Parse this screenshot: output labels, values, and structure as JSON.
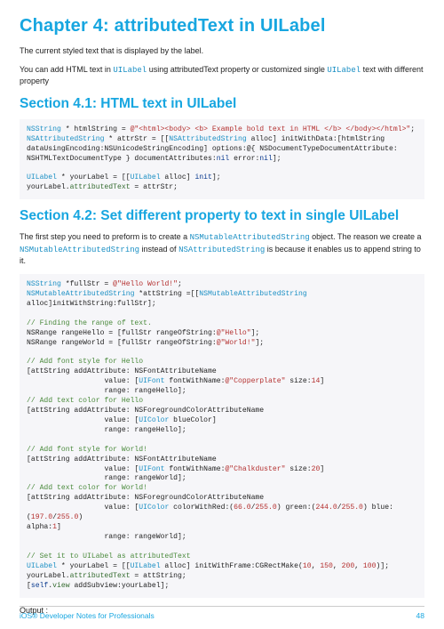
{
  "chapter_title": "Chapter 4: attributedText in UILabel",
  "intro_line": "The current styled text that is displayed by the label.",
  "intro_para_pre": "You can add HTML text in ",
  "intro_para_code": "UILabel",
  "intro_para_mid": " using attributedText property or customized single ",
  "intro_para_code2": "UILabel",
  "intro_para_post": " text with different property",
  "section41_title": "Section 4.1: HTML text in UILabel",
  "section42_title": "Section 4.2: Set different property to text in single UILabel",
  "section42_para_pre": "The first step you need to preform is to create a ",
  "section42_para_code1": "NSMutableAttributedString",
  "section42_para_mid": " object. The reason we create a ",
  "section42_para_code2": "NSMutableAttributedString",
  "section42_para_mid2": " instead of ",
  "section42_para_code3": "NSAttributedString",
  "section42_para_post": " is because it enables us to append string to it.",
  "output_label": "Output :",
  "footer_left": "iOS® Developer Notes for Professionals",
  "footer_right": "48",
  "code41": {
    "l1a": "NSString",
    "l1b": " * htmlString = ",
    "l1c": "@\"<html><body> <b> Example bold text in HTML </b> </body></html>\"",
    "l1d": ";",
    "l2a": "NSAttributedString",
    "l2b": " * attrStr = [[",
    "l2c": "NSAttributedString",
    "l2d": " alloc] initWithData:[htmlString",
    "l3": "dataUsingEncoding:NSUnicodeStringEncoding] options:@{ NSDocumentTypeDocumentAttribute:",
    "l4a": "NSHTMLTextDocumentType } documentAttributes:",
    "l4b": "nil",
    "l4c": " error:",
    "l4d": "nil",
    "l4e": "];",
    "l5a": "UILabel",
    "l5b": " * yourLabel = [[",
    "l5c": "UILabel",
    "l5d": " alloc] ",
    "l5e": "init",
    "l5f": "];",
    "l6a": "yourLabel.",
    "l6b": "attributedText",
    "l6c": " = attrStr;"
  },
  "code42": {
    "l1a": "NSString",
    "l1b": " *fullStr = ",
    "l1c": "@\"Hello World!\"",
    "l1d": ";",
    "l2a": "NSMutableAttributedString",
    "l2b": " *attString =[[",
    "l2c": "NSMutableAttributedString",
    "l2d": " alloc]initWithString:fullStr];",
    "c1": "// Finding the range of text.",
    "l3a": "NSRange rangeHello = [fullStr rangeOfString:",
    "l3b": "@\"Hello\"",
    "l3c": "];",
    "l4a": "NSRange rangeWorld = [fullStr rangeOfString:",
    "l4b": "@\"World!\"",
    "l4c": "];",
    "c2": "// Add font style for Hello",
    "l5": "[attString addAttribute: NSFontAttributeName",
    "l6a": "                  value: [",
    "l6b": "UIFont",
    "l6c": " fontWithName:",
    "l6d": "@\"Copperplate\"",
    "l6e": " size:",
    "l6f": "14",
    "l6g": "]",
    "l7": "                  range: rangeHello];",
    "c3": "// Add text color for Hello",
    "l8": "[attString addAttribute: NSForegroundColorAttributeName",
    "l9a": "                  value: [",
    "l9b": "UIColor",
    "l9c": " blueColor]",
    "l10": "                  range: rangeHello];",
    "c4": "// Add font style for World!",
    "l11": "[attString addAttribute: NSFontAttributeName",
    "l12a": "                  value: [",
    "l12b": "UIFont",
    "l12c": " fontWithName:",
    "l12d": "@\"Chalkduster\"",
    "l12e": " size:",
    "l12f": "20",
    "l12g": "]",
    "l13": "                  range: rangeWorld];",
    "c5": "// Add text color for World!",
    "l14": "[attString addAttribute: NSForegroundColorAttributeName",
    "l15a": "                  value: [",
    "l15b": "UIColor",
    "l15c": " colorWithRed:(",
    "l15d": "66.0",
    "l15e": "/",
    "l15f": "255.0",
    "l15g": ") green:(",
    "l15h": "244.0",
    "l15i": "/",
    "l15j": "255.0",
    "l15k": ") blue:(",
    "l15l": "197.0",
    "l15m": "/",
    "l15n": "255.0",
    "l15o": ")",
    "l16a": "alpha:",
    "l16b": "1",
    "l16c": "]",
    "l17": "                  range: rangeWorld];",
    "c6": "// Set it to UILabel as attributedText",
    "l18a": "UILabel",
    "l18b": " * yourLabel = [[",
    "l18c": "UILabel",
    "l18d": " alloc] initWithFrame:CGRectMake(",
    "l18e": "10",
    "l18f": ", ",
    "l18g": "150",
    "l18h": ", ",
    "l18i": "200",
    "l18j": ", ",
    "l18k": "100",
    "l18l": ")];",
    "l19a": "yourLabel.",
    "l19b": "attributedText",
    "l19c": " = attString;",
    "l20a": "[",
    "l20b": "self",
    "l20c": ".",
    "l20d": "view",
    "l20e": " addSubview:yourLabel];"
  }
}
